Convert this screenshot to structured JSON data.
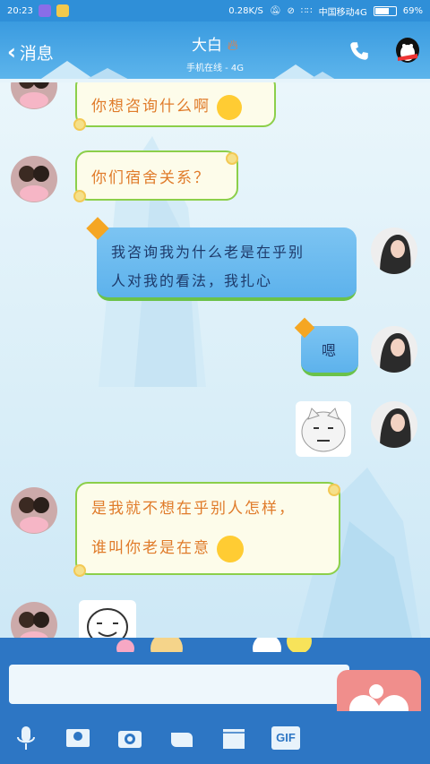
{
  "status_bar": {
    "time": "20:23",
    "speed": "0.28K/S",
    "carrier": "中国移动4G",
    "battery_level": 0.69,
    "battery_text": "69%"
  },
  "header": {
    "back_label": "消息",
    "title": "大白",
    "subtitle": "手机在线 - 4G"
  },
  "messages": [
    {
      "side": "in",
      "text": "你想咨询什么啊"
    },
    {
      "side": "in",
      "text": "你们宿舍关系？"
    },
    {
      "side": "out",
      "lines": [
        "我咨询我为什么老是在乎别",
        "人对我的看法，我扎心"
      ]
    },
    {
      "side": "out",
      "text": "嗯"
    },
    {
      "side": "out",
      "sticker": "cat-face"
    },
    {
      "side": "in",
      "lines": [
        "是我就不想在乎别人怎样，",
        "谁叫你老是在意"
      ]
    },
    {
      "side": "in",
      "sticker": "smile-face"
    }
  ],
  "input": {
    "placeholder": "",
    "value": ""
  },
  "toolbar": {
    "gif_label": "GIF"
  },
  "colors": {
    "header": "#3a9be0",
    "incoming_text": "#e07b2a",
    "outgoing_bubble": "#5db2ec",
    "toolbar": "#2d76c4",
    "heart_button": "#f08e8c"
  }
}
